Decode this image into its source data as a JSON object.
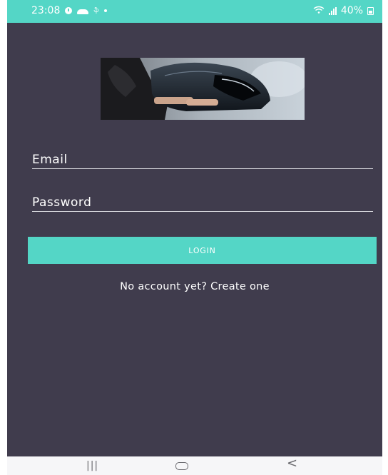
{
  "status_bar": {
    "time": "23:08",
    "notification_text": "ֆ",
    "battery": "40%",
    "colors": {
      "background": "#54d6c6"
    },
    "icons": [
      "alarm-icon",
      "cloud-icon",
      "dot-icon",
      "wifi-icon",
      "signal-icon",
      "battery-icon"
    ]
  },
  "login": {
    "email_label": "Email",
    "password_label": "Password",
    "login_button": "LOGIN",
    "signup_link": "No account yet? Create one",
    "hero_image": "person-holding-motorcycle-helmet-image"
  },
  "navigation_bar": {
    "recents": "|||",
    "back": "<",
    "icons": [
      "recents-icon",
      "home-icon",
      "back-icon"
    ]
  },
  "theme": {
    "background": "#403c4d",
    "accent": "#54d6c6",
    "text": "#ffffff"
  }
}
